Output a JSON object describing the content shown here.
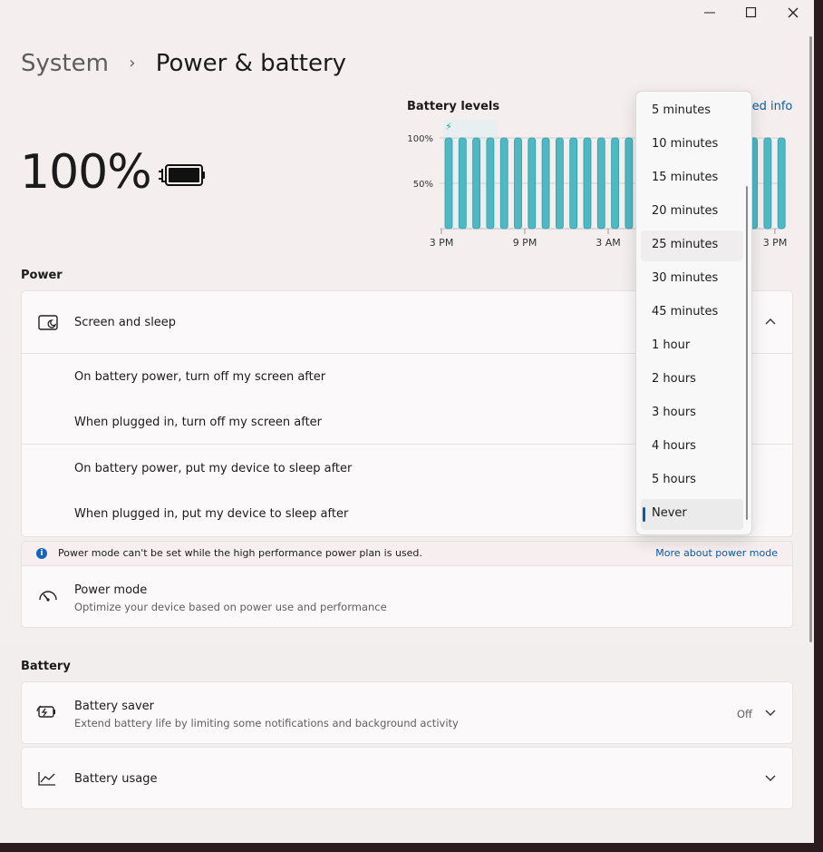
{
  "window": {
    "minimize_glyph": "—",
    "maximize_glyph": "☐",
    "close_glyph": "✕"
  },
  "breadcrumb": {
    "parent": "System",
    "separator": "›",
    "current": "Power & battery"
  },
  "battery": {
    "percent_text": "100%",
    "level": 1.0
  },
  "chart_data": {
    "type": "bar",
    "title": "Battery levels",
    "link_text": "led info",
    "y_ticks": [
      "100%",
      "50%"
    ],
    "x_ticks": [
      "3 PM",
      "9 PM",
      "3 AM",
      "3 PM"
    ],
    "ylim": [
      0,
      100
    ],
    "values": [
      100,
      100,
      100,
      100,
      100,
      100,
      100,
      100,
      100,
      100,
      100,
      100,
      100,
      100,
      100,
      100,
      100,
      100,
      100,
      100,
      100,
      100,
      100,
      100,
      100
    ],
    "plug_marker": "⚡",
    "colors": {
      "bar": "#4fb8c3",
      "bar_edge": "#2f9ca8",
      "band": "#e6f0f1"
    }
  },
  "power_section": {
    "label": "Power",
    "screen_and_sleep": {
      "label": "Screen and sleep",
      "rows": [
        "On battery power, turn off my screen after",
        "When plugged in, turn off my screen after",
        "On battery power, put my device to sleep after",
        "When plugged in, put my device to sleep after"
      ]
    },
    "info_bar": {
      "icon_text": "i",
      "text": "Power mode can't be set while the high performance power plan is used.",
      "link": "More about power mode"
    },
    "power_mode": {
      "label": "Power mode",
      "description": "Optimize your device based on power use and performance"
    }
  },
  "battery_section": {
    "label": "Battery",
    "battery_saver": {
      "label": "Battery saver",
      "description": "Extend battery life by limiting some notifications and background activity",
      "status": "Off"
    },
    "battery_usage": {
      "label": "Battery usage"
    }
  },
  "dropdown": {
    "options": [
      "5 minutes",
      "10 minutes",
      "15 minutes",
      "20 minutes",
      "25 minutes",
      "30 minutes",
      "45 minutes",
      "1 hour",
      "2 hours",
      "3 hours",
      "4 hours",
      "5 hours",
      "Never"
    ],
    "hovered": "25 minutes",
    "selected": "Never"
  },
  "colors": {
    "accent": "#0a5aa8"
  }
}
